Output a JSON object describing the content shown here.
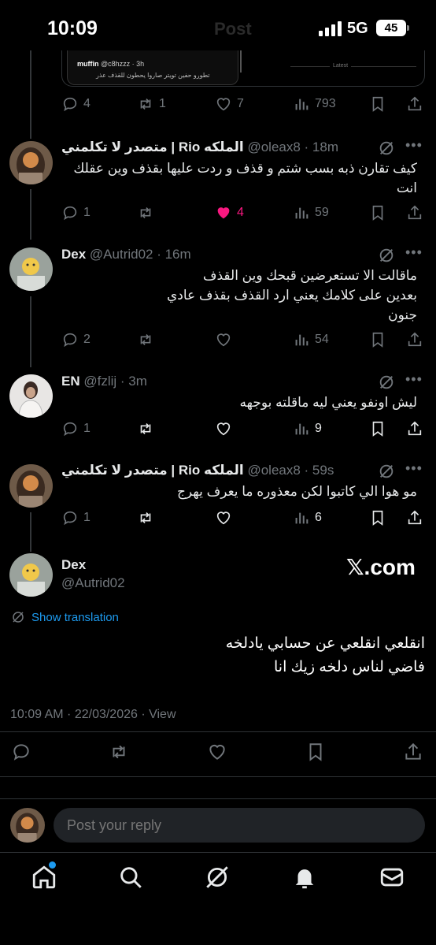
{
  "status_bar": {
    "time": "10:09",
    "ghost_title": "Post",
    "network": "5G",
    "battery": "45"
  },
  "quoted_preview": {
    "name": "muffin",
    "handle": "@c8hzzz · 3h",
    "text": "تطورو حفين تويتر صاروا يحطون للقذف عذر",
    "side_label": "Latest"
  },
  "first_stats": {
    "replies": "4",
    "reposts": "1",
    "likes": "7",
    "views": "793"
  },
  "replies": [
    {
      "name": "الملكه Rio | متصدر لا تكلمني",
      "handle": "@oleax8 · 18m",
      "body": "كيف تقارن ذبه بسب شتم و قذف و ردت عليها بقذف وين عقلك\nانت",
      "replies": "1",
      "reposts": "",
      "likes": "4",
      "views": "59",
      "liked": true
    },
    {
      "name": "Dex",
      "handle": "@Autrid02 · 16m",
      "body": "ماقالت الا تستعرضين قبحك وين القذف\nبعدين على كلامك يعني ارد القذف بقذف عادي\nجنون",
      "replies": "2",
      "reposts": "",
      "likes": "",
      "views": "54",
      "liked": false
    },
    {
      "name": "EN",
      "handle": "@fzlij · 3m",
      "body": "ليش اونفو يعني ليه ماقلته بوجهه",
      "replies": "1",
      "reposts": "",
      "likes": "",
      "views": "9",
      "liked": false
    },
    {
      "name": "الملكه Rio | متصدر لا تكلمني",
      "handle": "@oleax8 · 59s",
      "body": "مو هوا الي كاتبوا لكن معذوره ما يعرف يهرج",
      "replies": "1",
      "reposts": "",
      "likes": "",
      "views": "6",
      "liked": false
    }
  ],
  "main_post": {
    "name": "Dex",
    "handle": "@Autrid02",
    "watermark": "𝕏.com",
    "translate_label": "Show translation",
    "body": "انقلعي انقلعي عن حسابي يادلخه\nفاضي لناس دلخه زيك انا",
    "timestamp": "10:09 AM · 22/03/2026 · View"
  },
  "reply_bar": {
    "placeholder": "Post your reply"
  },
  "tabs": [
    "home",
    "search",
    "grok",
    "notifications",
    "messages"
  ],
  "colors": {
    "accent": "#1d9bf0",
    "like": "#f91880",
    "muted": "#71767b",
    "background": "#000000"
  }
}
